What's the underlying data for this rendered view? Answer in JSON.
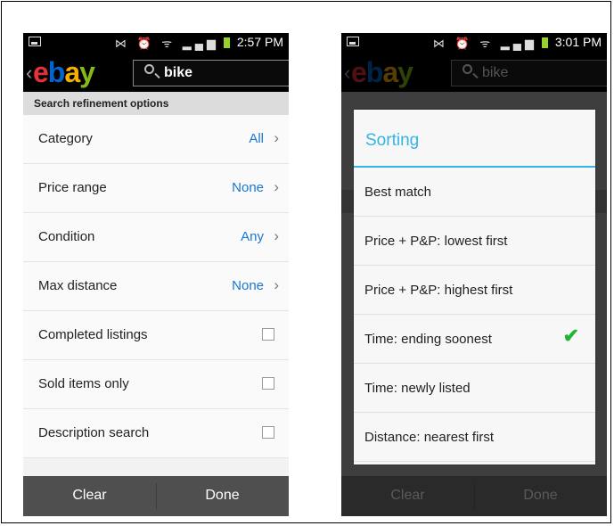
{
  "left": {
    "status_time": "2:57 PM",
    "search_query": "bike",
    "section_title": "Search refinement options",
    "rows": [
      {
        "label": "Category",
        "value": "All"
      },
      {
        "label": "Price range",
        "value": "None"
      },
      {
        "label": "Condition",
        "value": "Any"
      },
      {
        "label": "Max distance",
        "value": "None"
      }
    ],
    "checkbox_rows": [
      {
        "label": "Completed listings"
      },
      {
        "label": "Sold items only"
      },
      {
        "label": "Description search"
      }
    ],
    "clear_label": "Clear",
    "done_label": "Done"
  },
  "right": {
    "status_time": "3:01 PM",
    "search_query": "bike",
    "dialog_title": "Sorting",
    "options": [
      {
        "label": "Best match",
        "selected": false
      },
      {
        "label": "Price + P&P: lowest first",
        "selected": false
      },
      {
        "label": "Price + P&P: highest first",
        "selected": false
      },
      {
        "label": "Time: ending soonest",
        "selected": true
      },
      {
        "label": "Time: newly listed",
        "selected": false
      },
      {
        "label": "Distance: nearest first",
        "selected": false
      }
    ],
    "clear_label": "Clear",
    "done_label": "Done"
  },
  "brand": {
    "logo_letters": [
      "e",
      "b",
      "a",
      "y"
    ],
    "colors": {
      "e": "#e53238",
      "b": "#0064d2",
      "a": "#f5af02",
      "y": "#86b817",
      "accent": "#33b5e5",
      "check": "#22b535"
    }
  },
  "icons": {
    "status_left": "image-icon",
    "status_right": [
      "missed-call-icon",
      "alarm-icon",
      "wifi-icon",
      "signal-icon",
      "battery-icon"
    ],
    "search": "magnifier-icon",
    "chevron": "chevron-right-icon",
    "check": "checkmark-icon"
  }
}
